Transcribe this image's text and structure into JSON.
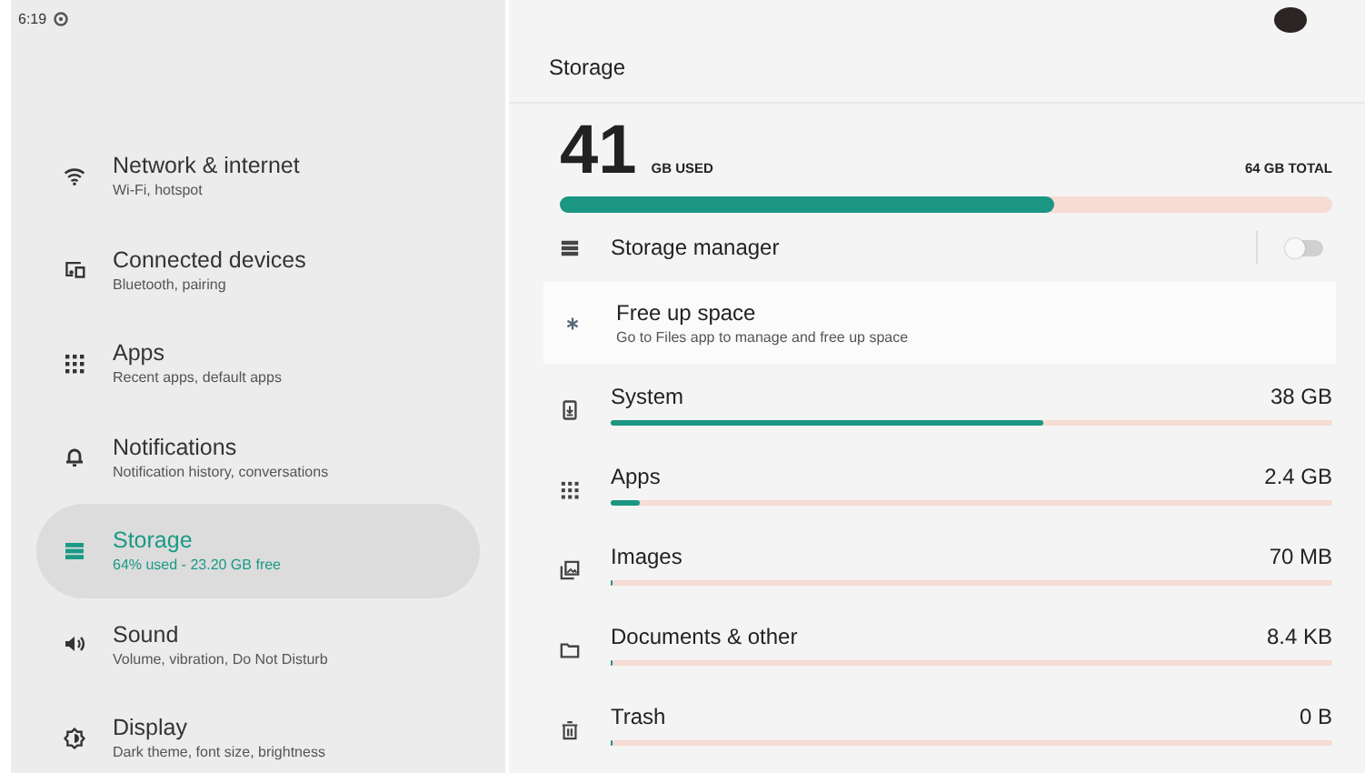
{
  "status_bar": {
    "time": "6:19"
  },
  "sidebar": {
    "items": [
      {
        "title": "Network & internet",
        "subtitle": "Wi-Fi, hotspot",
        "selected": false
      },
      {
        "title": "Connected devices",
        "subtitle": "Bluetooth, pairing",
        "selected": false
      },
      {
        "title": "Apps",
        "subtitle": "Recent apps, default apps",
        "selected": false
      },
      {
        "title": "Notifications",
        "subtitle": "Notification history, conversations",
        "selected": false
      },
      {
        "title": "Storage",
        "subtitle": "64% used - 23.20 GB free",
        "selected": true
      },
      {
        "title": "Sound",
        "subtitle": "Volume, vibration, Do Not Disturb",
        "selected": false
      },
      {
        "title": "Display",
        "subtitle": "Dark theme, font size, brightness",
        "selected": false
      }
    ]
  },
  "page": {
    "title": "Storage",
    "summary": {
      "used_number": "41",
      "used_label": "GB USED",
      "total_label": "64 GB TOTAL",
      "level": 0.64
    },
    "storage_manager": {
      "label": "Storage manager",
      "on": false
    },
    "free_up": {
      "title": "Free up space",
      "subtitle": "Go to Files app to manage and free up space"
    },
    "categories": [
      {
        "name": "System",
        "size": "38 GB",
        "level": 0.6
      },
      {
        "name": "Apps",
        "size": "2.4 GB",
        "level": 0.04
      },
      {
        "name": "Images",
        "size": "70 MB",
        "level": 0
      },
      {
        "name": "Documents & other",
        "size": "8.4 KB",
        "level": 0
      },
      {
        "name": "Trash",
        "size": "0 B",
        "level": 0
      }
    ]
  }
}
